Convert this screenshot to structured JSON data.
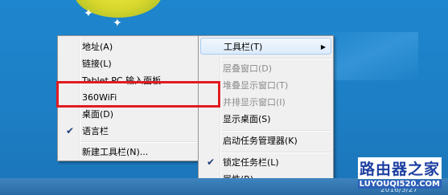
{
  "menu_left": {
    "items": [
      {
        "label": "地址(A)",
        "checked": false,
        "disabled": false
      },
      {
        "label": "链接(L)",
        "checked": false,
        "disabled": false
      },
      {
        "label": "Tablet PC 输入面板",
        "checked": false,
        "disabled": false
      },
      {
        "label": "360WiFi",
        "checked": false,
        "disabled": false
      },
      {
        "label": "桌面(D)",
        "checked": false,
        "disabled": false
      },
      {
        "label": "语言栏",
        "checked": true,
        "disabled": false
      },
      {
        "label": "新建工具栏(N)...",
        "checked": false,
        "disabled": false
      }
    ]
  },
  "menu_right": {
    "items": [
      {
        "label": "工具栏(T)",
        "has_submenu": true,
        "highlighted": true
      },
      {
        "label": "层叠窗口(D)",
        "disabled": true
      },
      {
        "label": "堆叠显示窗口(T)",
        "disabled": true
      },
      {
        "label": "并排显示窗口(I)",
        "disabled": true
      },
      {
        "label": "显示桌面(S)",
        "disabled": false
      },
      {
        "label": "启动任务管理器(K)",
        "disabled": false
      },
      {
        "label": "锁定任务栏(L)",
        "checked": true,
        "disabled": false
      },
      {
        "label": "属性(R)",
        "disabled": false
      }
    ]
  },
  "icons": {
    "check": "✔",
    "submenu_arrow": "▶"
  },
  "watermark": {
    "title": "路由器之家",
    "url": "LUYOUQI520.COM"
  },
  "clock": {
    "date": "2016/5/27"
  },
  "colors": {
    "highlight_box": "#E11B22",
    "desktop": "#1E86CE",
    "menu_bg": "#F0F0F0"
  }
}
